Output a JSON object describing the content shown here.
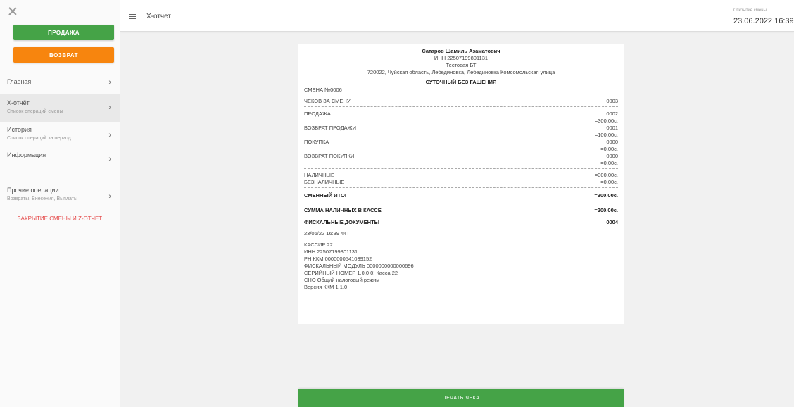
{
  "sidebar": {
    "sale_button": "ПРОДАЖА",
    "return_button": "ВОЗВРАТ",
    "items": [
      {
        "label": "Главная",
        "sub": ""
      },
      {
        "label": "X-отчёт",
        "sub": "Список операций смены"
      },
      {
        "label": "История",
        "sub": "Список операций за период"
      },
      {
        "label": "Информация",
        "sub": ""
      },
      {
        "label": "Прочие операции",
        "sub": "Возвраты, Внесения, Выплаты"
      }
    ],
    "closing_link": "ЗАКРЫТИЕ СМЕНЫ И Z-ОТЧЕТ"
  },
  "header": {
    "title": "X-отчет",
    "shift_label": "Открытие смены",
    "shift_date": "23.06.2022 16:39"
  },
  "receipt": {
    "owner": "Сатаров Шамиль Азаматович",
    "inn": "ИНН 22507199801131",
    "shop": "Тестовая БТ",
    "address": "720022, Чуйская область, Лебединовка, Лебединовка Комсомольская улица",
    "report_title": "СУТОЧНЫЙ БЕЗ ГАШЕНИЯ",
    "shift_number": "СМЕНА №0006",
    "checks_label": "ЧЕКОВ ЗА СМЕНУ",
    "checks_value": "0003",
    "sale_label": "ПРОДАЖА",
    "sale_count": "0002",
    "sale_sum": "=300.00с.",
    "sale_return_label": "ВОЗВРАТ ПРОДАЖИ",
    "sale_return_count": "0001",
    "sale_return_sum": "=100.00с.",
    "purchase_label": "ПОКУПКА",
    "purchase_count": "0000",
    "purchase_sum": "=0.00с.",
    "purchase_return_label": "ВОЗВРАТ ПОКУПКИ",
    "purchase_return_count": "0000",
    "purchase_return_sum": "=0.00с.",
    "cash_label": "НАЛИЧНЫЕ",
    "cash_value": "=300.00с.",
    "noncash_label": "БЕЗНАЛИЧНЫЕ",
    "noncash_value": "=0.00с.",
    "shift_total_label": "СМЕННЫЙ ИТОГ",
    "shift_total_value": "=300.00с.",
    "cash_in_register_label": "СУММА НАЛИЧНЫХ В КАССЕ",
    "cash_in_register_value": "=200.00с.",
    "fiscal_docs_label": "ФИСКАЛЬНЫЕ ДОКУМЕНТЫ",
    "fiscal_docs_value": "0004",
    "datetime": "23/06/22 16:39 ФП",
    "cashier": "КАССИР 22",
    "cashier_inn": "ИНН 22507199801131",
    "rn_kkm": "РН ККМ 0000000541039152",
    "fiscal_module": "ФИСКАЛЬНЫЙ МОДУЛЬ 0000000000000696",
    "serial": "СЕРИЙНЫЙ НОМЕР 1.0.0 0! Касса 22",
    "tax_mode": "СНО Общий налоговый режим",
    "kkm_version": "Версия ККМ 1.1.0"
  },
  "print_button": "ПЕЧАТЬ ЧЕКА",
  "colors": {
    "green": "#45a347",
    "orange": "#f7850e",
    "red_link": "#e54848"
  },
  "icons": {
    "close": "close-icon",
    "menu": "hamburger-icon",
    "chevron": "chevron-right-icon"
  }
}
